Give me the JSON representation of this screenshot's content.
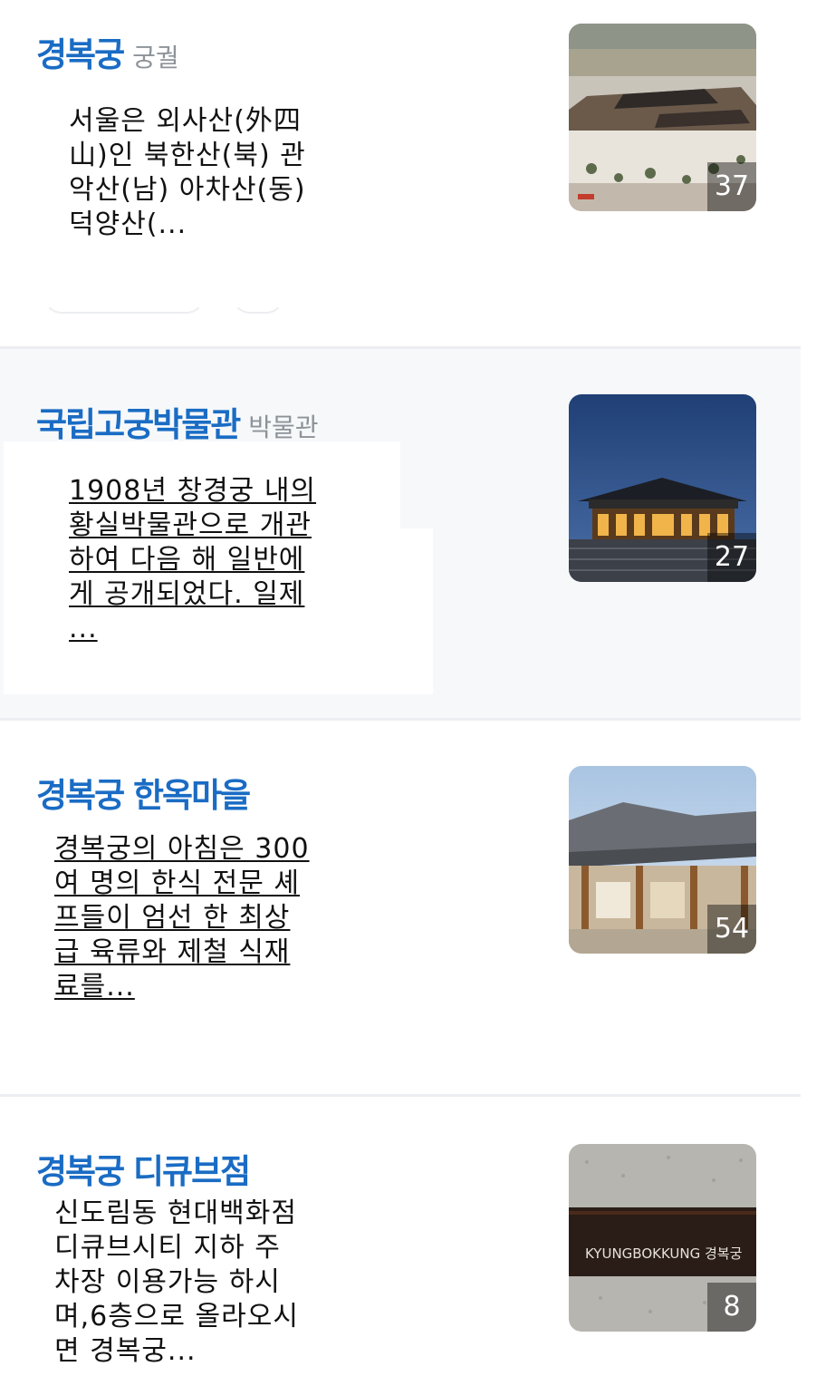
{
  "results": [
    {
      "title": "경복궁",
      "category": "궁궐",
      "description": "서울은 외사산(外四山)인 북한산(북) 관악산(남) 아차산(동) 덕양산(...",
      "description_lines": [
        "서울은 외사산(外四",
        "山)인 북한산(북) 관",
        "악산(남) 아차산(동)",
        "덕양산(..."
      ],
      "photo_count": "37"
    },
    {
      "title": "국립고궁박물관",
      "category": "박물관",
      "description": "1908년 창경궁 내의 황실박물관으로 개관하여 다음 해 일반에게 공개되었다. 일제...",
      "description_lines": [
        "1908년 창경궁 내의",
        "황실박물관으로 개관",
        "하여 다음 해 일반에",
        "게 공개되었다. 일제",
        "..."
      ],
      "photo_count": "27"
    },
    {
      "title": "경복궁 한옥마을",
      "category": "",
      "description": "경복궁의 아침은 300여 명의 한식 전문 셰프들이 엄선 한 최상급 육류와 제철 식재료를...",
      "description_lines": [
        "경복궁의 아침은 300",
        "여 명의 한식 전문 셰",
        "프들이 엄선 한 최상",
        "급 육류와 제철 식재",
        "료를..."
      ],
      "photo_count": "54"
    },
    {
      "title": "경복궁 디큐브점",
      "category": "",
      "description": "신도림동 현대백화점 디큐브시티 지하 주차장 이용가능 하시며,6층으로 올라오시면 경복궁...",
      "description_lines": [
        "신도림동 현대백화점",
        "디큐브시티 지하 주",
        "차장 이용가능 하시",
        "며,6층으로 올라오시",
        "면 경복궁..."
      ],
      "photo_count": "8",
      "sign_text": "KYUNGBOKKUNG 경복궁"
    }
  ],
  "colors": {
    "title": "#1a6cc4",
    "category": "#8d9399",
    "divider": "#eceef1",
    "alt_background": "#f6f8fa"
  }
}
